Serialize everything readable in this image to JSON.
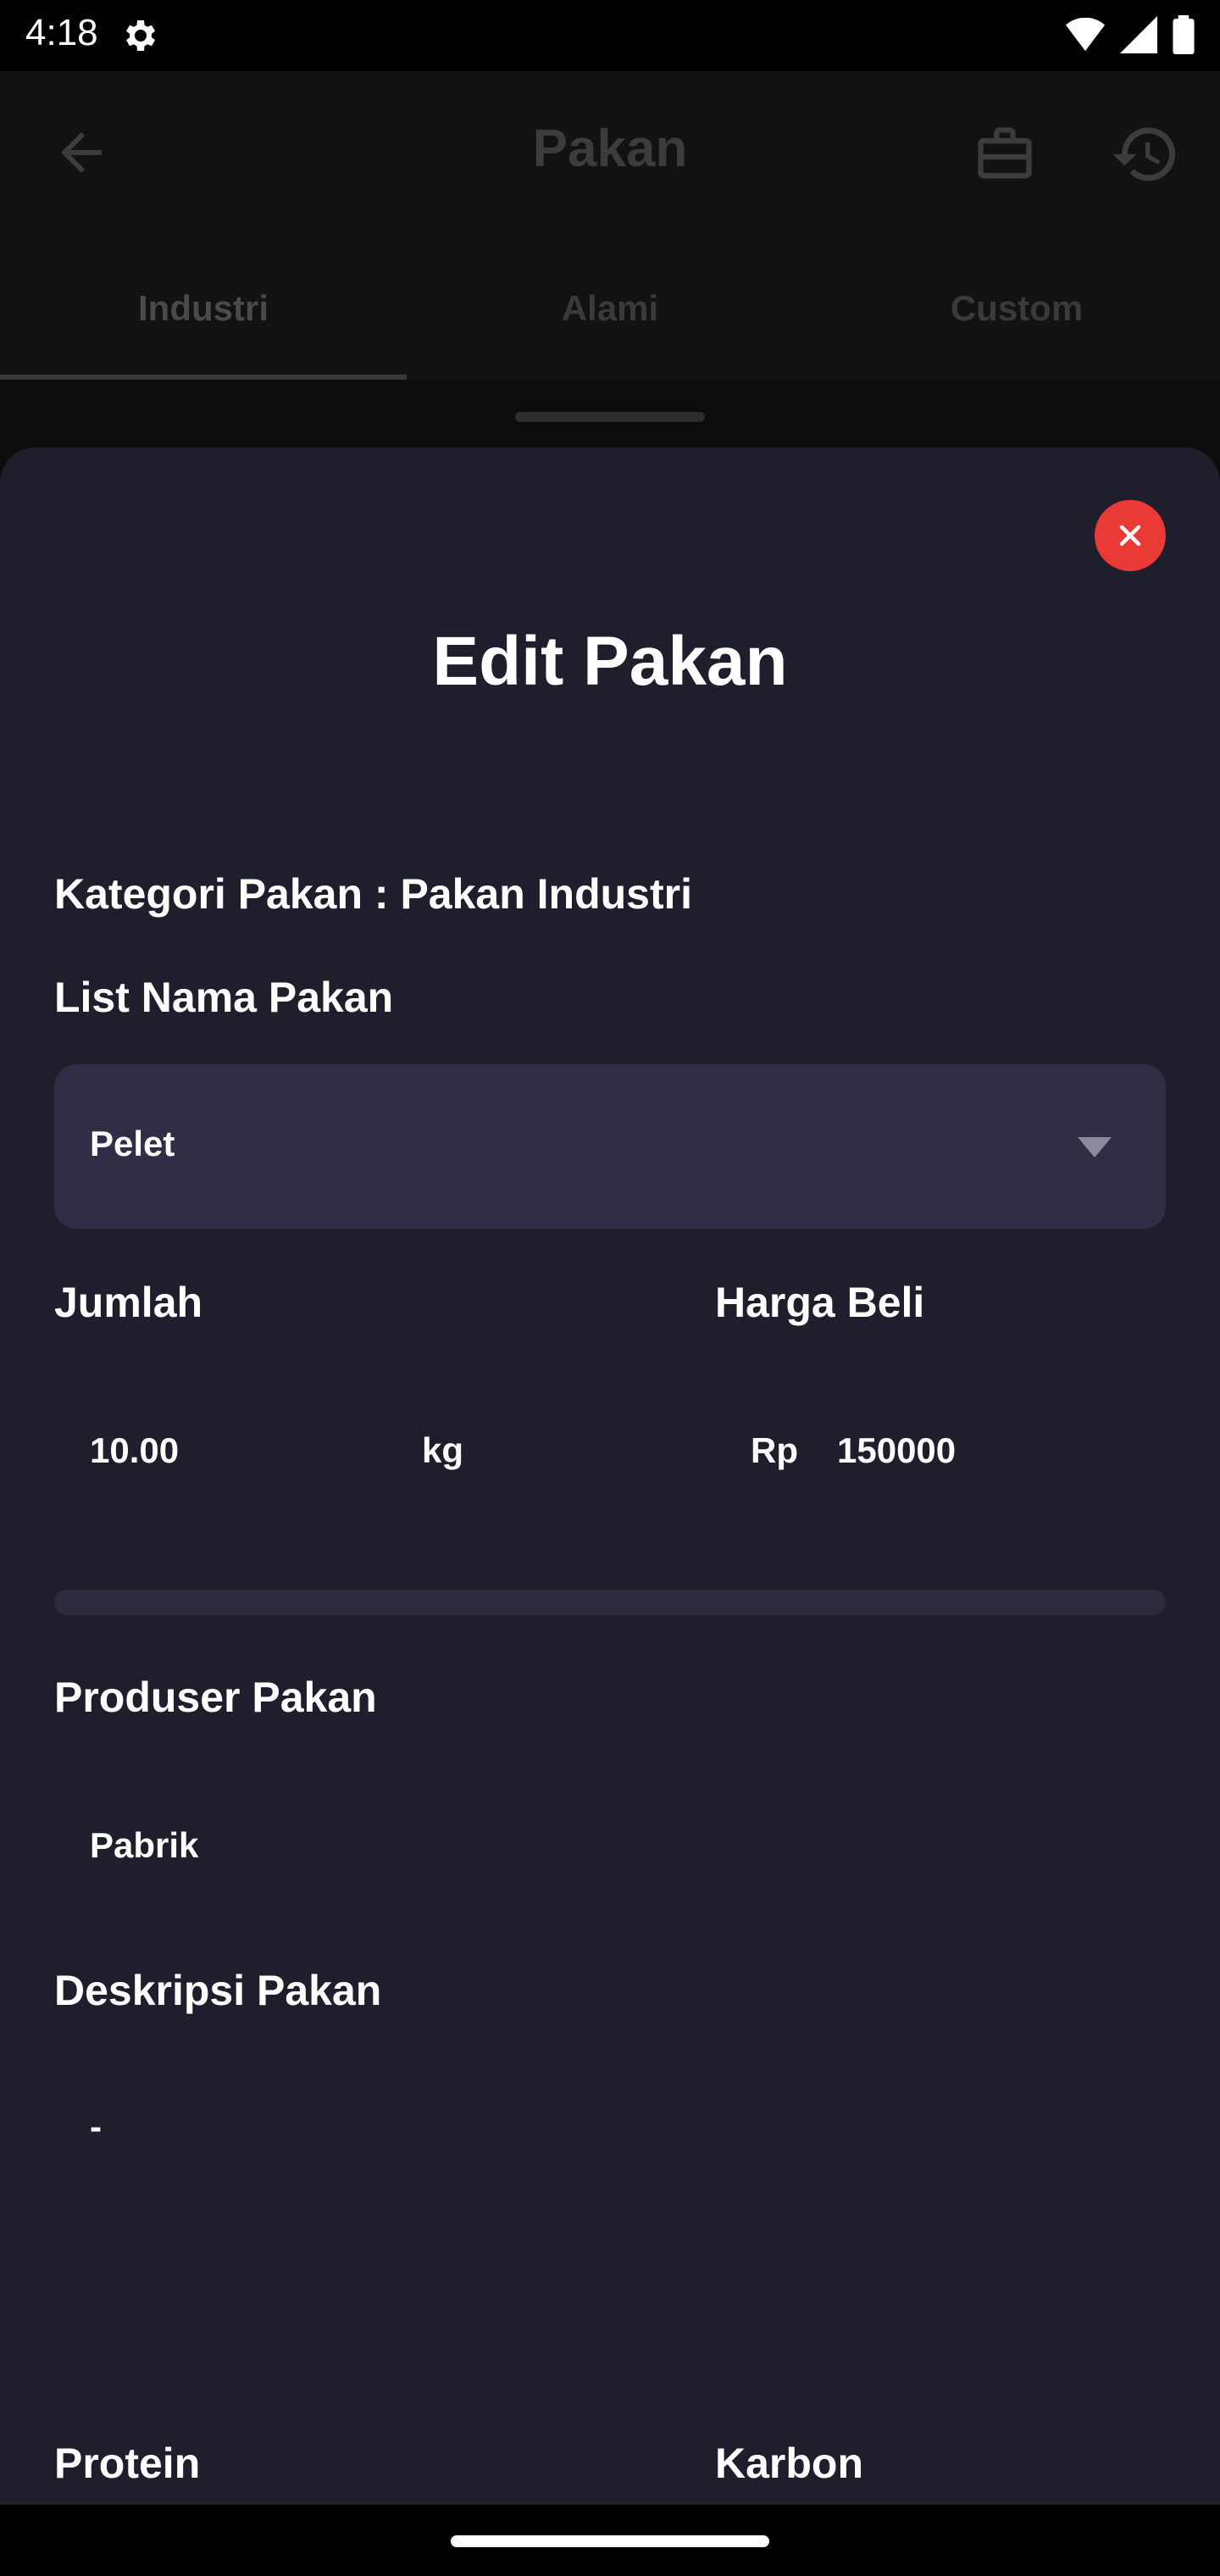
{
  "status_bar": {
    "time": "4:18"
  },
  "app_bar": {
    "title": "Pakan"
  },
  "tabs": [
    {
      "label": "Industri",
      "active": true
    },
    {
      "label": "Alami",
      "active": false
    },
    {
      "label": "Custom",
      "active": false
    }
  ],
  "sheet": {
    "title": "Edit Pakan",
    "category_label": "Kategori Pakan : Pakan Industri",
    "list_label": "List Nama Pakan",
    "selected_feed": "Pelet",
    "amount_label": "Jumlah",
    "amount_value": "10.00",
    "amount_unit": "kg",
    "price_label": "Harga Beli",
    "price_currency": "Rp",
    "price_value": "150000",
    "producer_label": "Produser Pakan",
    "producer_value": "Pabrik",
    "description_label": "Deskripsi Pakan",
    "description_value": "-",
    "protein_label": "Protein",
    "carbon_label": "Karbon"
  },
  "colors": {
    "sheet_bg": "#1f1e2d",
    "field_bg": "#302e47",
    "close_red": "#ea3a36"
  },
  "icons": [
    "settings-icon",
    "wifi-icon",
    "signal-icon",
    "battery-icon",
    "back-arrow-icon",
    "briefcase-icon",
    "history-icon",
    "close-icon",
    "dropdown-caret-icon"
  ]
}
